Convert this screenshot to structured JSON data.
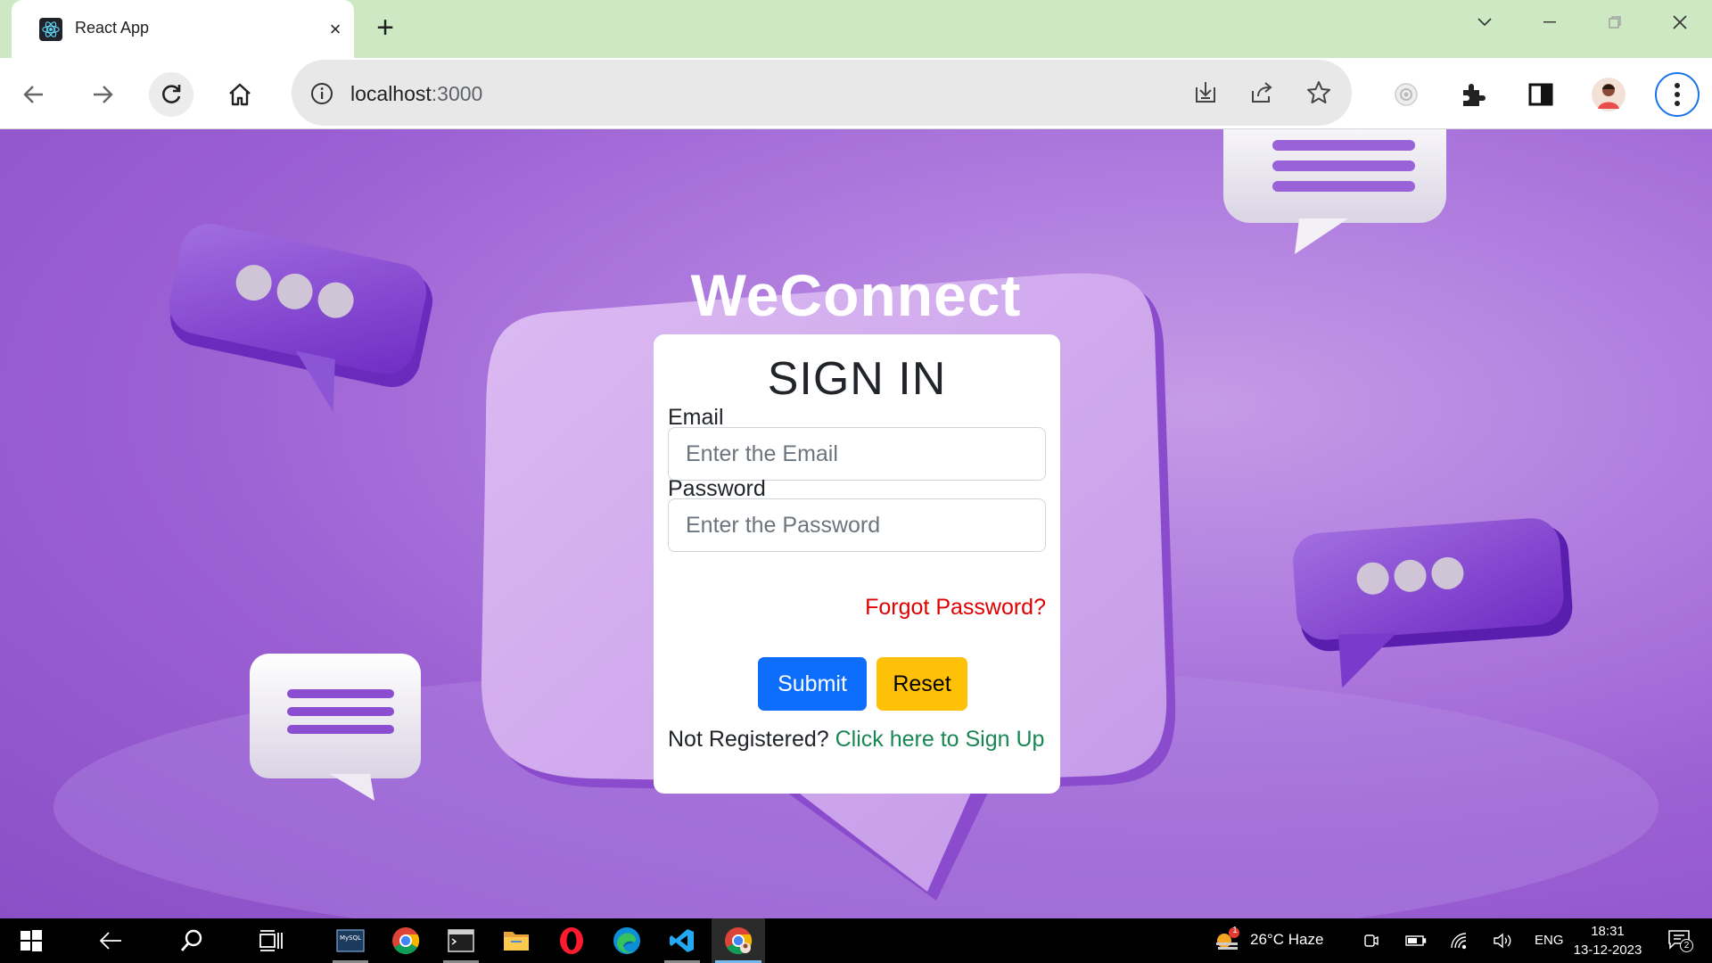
{
  "browser": {
    "tab_title": "React App",
    "close_tab_symbol": "×",
    "new_tab_symbol": "+",
    "url_host": "localhost",
    "url_port": ":3000"
  },
  "page": {
    "brand": "WeConnect",
    "form": {
      "title": "SIGN IN",
      "email_label": "Email",
      "email_placeholder": "Enter the Email",
      "password_label": "Password",
      "password_placeholder": "Enter the Password",
      "forgot_link": "Forgot Password?",
      "submit_label": "Submit",
      "reset_label": "Reset",
      "register_prompt": "Not Registered?",
      "register_link": "Click here to Sign Up"
    }
  },
  "taskbar": {
    "weather": "26°C  Haze",
    "weather_alert_count": "1",
    "language": "ENG",
    "time": "18:31",
    "date": "13-12-2023",
    "notification_count": "2",
    "mysql_label": "MySQL"
  },
  "colors": {
    "tab_strip": "#cde8c3",
    "submit": "#0d6efd",
    "reset": "#ffc107",
    "forgot": "#e00000",
    "register_link": "#198754",
    "page_bg": "#a46fd9"
  },
  "icons": [
    "react-favicon-icon",
    "close-icon",
    "plus-icon",
    "chevron-down-icon",
    "minimize-icon",
    "restore-icon",
    "back-arrow-icon",
    "forward-arrow-icon",
    "reload-icon",
    "home-icon",
    "info-icon",
    "install-icon",
    "share-icon",
    "star-icon",
    "extension-puzzle-icon",
    "side-panel-icon",
    "profile-avatar",
    "kebab-menu-icon",
    "windows-start-icon",
    "search-icon",
    "task-view-icon",
    "chrome-icon",
    "terminal-icon",
    "folder-icon",
    "opera-icon",
    "edge-icon",
    "vscode-icon",
    "notification-icon"
  ]
}
